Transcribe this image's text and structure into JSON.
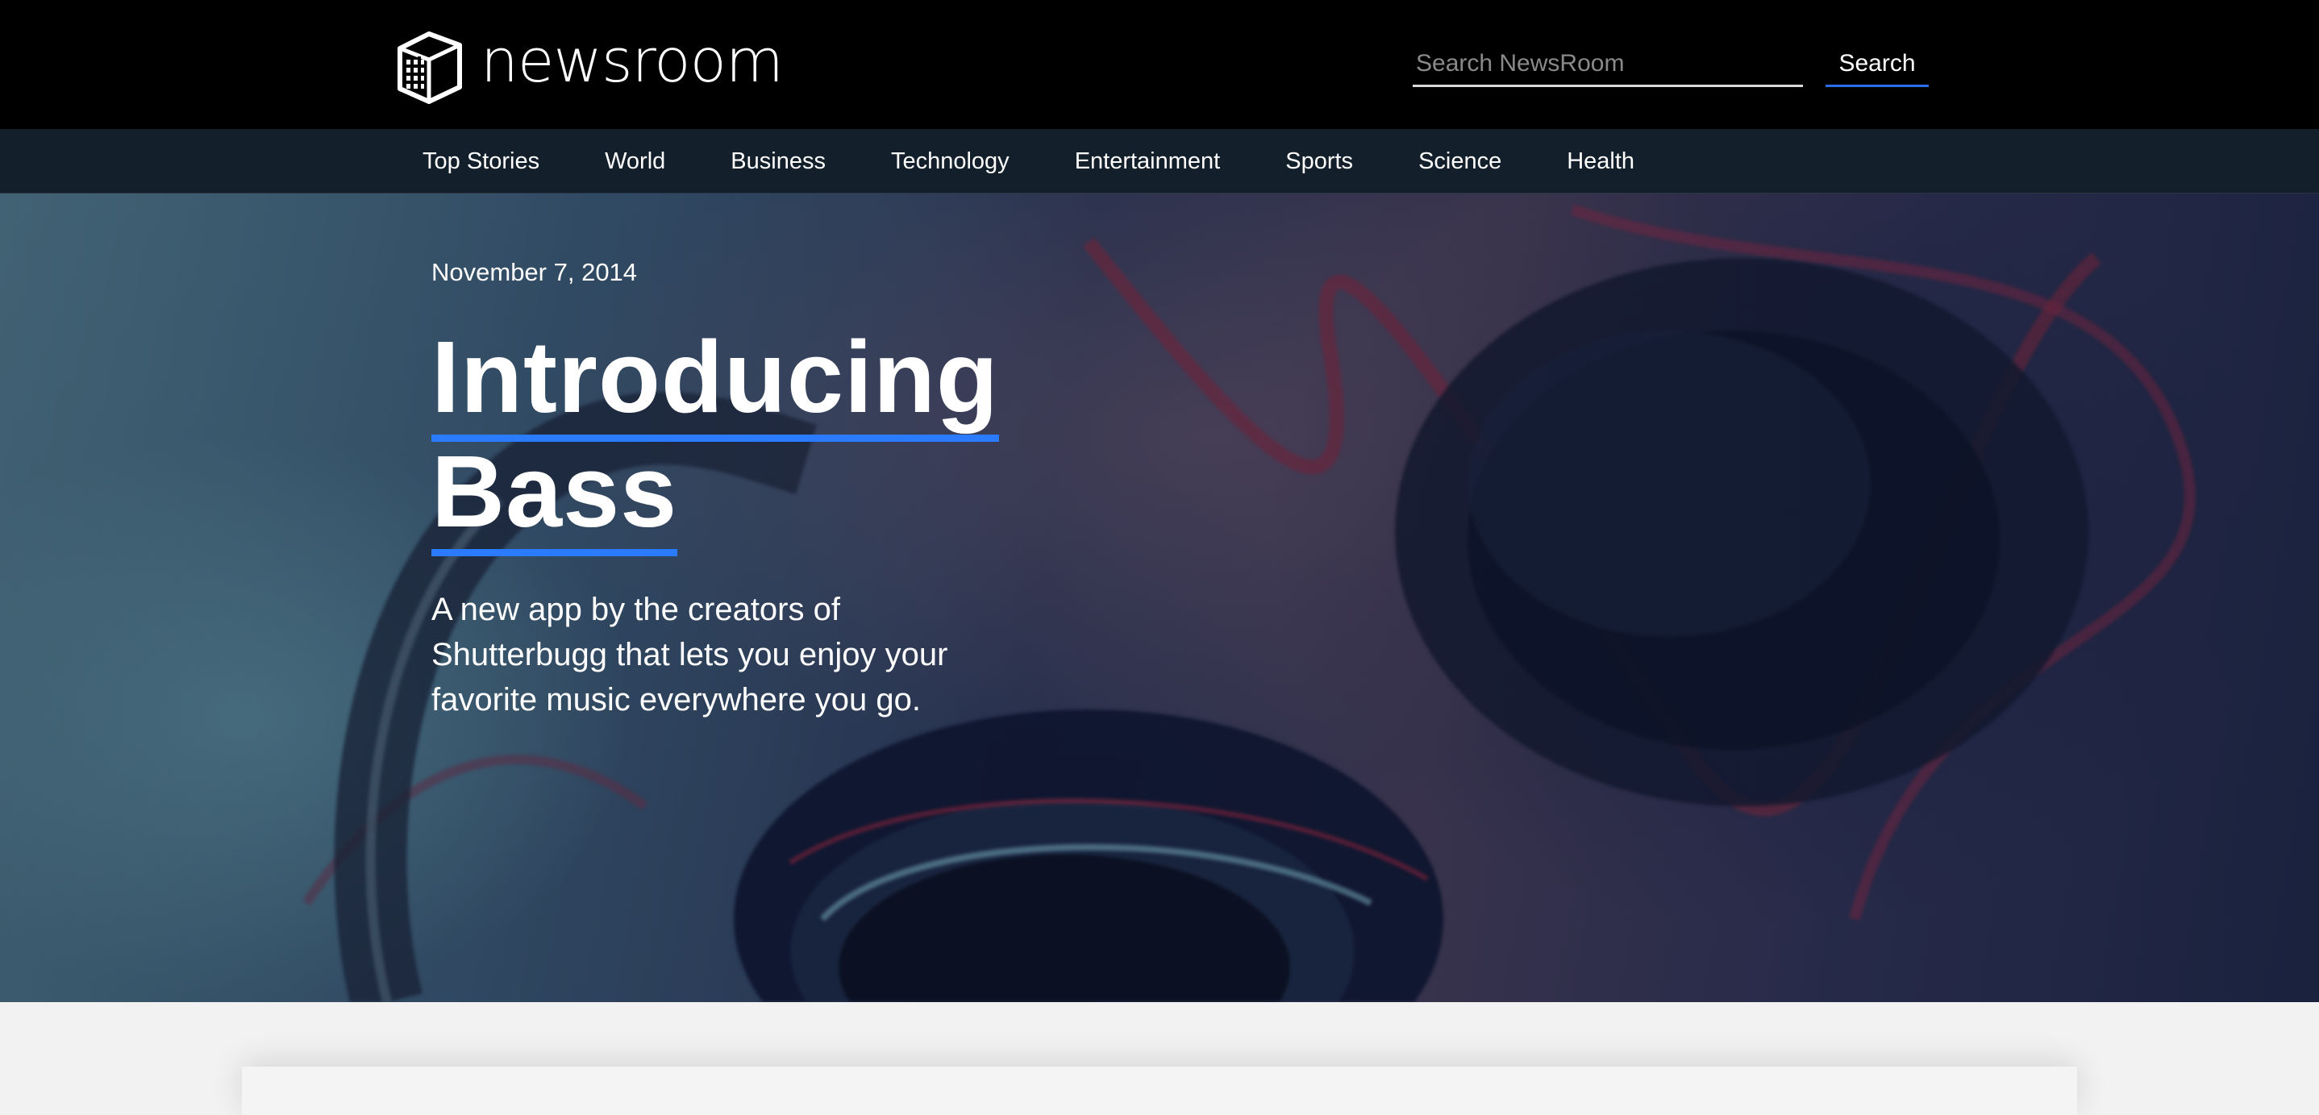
{
  "header": {
    "logo_text": "newsroom",
    "search": {
      "placeholder": "Search NewsRoom",
      "value": "",
      "button_label": "Search"
    }
  },
  "nav": {
    "items": [
      {
        "label": "Top Stories"
      },
      {
        "label": "World"
      },
      {
        "label": "Business"
      },
      {
        "label": "Technology"
      },
      {
        "label": "Entertainment"
      },
      {
        "label": "Sports"
      },
      {
        "label": "Science"
      },
      {
        "label": "Health"
      }
    ]
  },
  "hero": {
    "date": "November 7, 2014",
    "title_line_1": "Introducing",
    "title_line_2": "Bass",
    "description": "A new app by the creators of Shutterbugg that lets you enjoy your favorite music everywhere you go.",
    "image_subject": "headphones"
  },
  "colors": {
    "header_bg": "#000000",
    "nav_bg": "#13202b",
    "accent": "#2a7bff",
    "page_bg": "#f2f2f2"
  }
}
